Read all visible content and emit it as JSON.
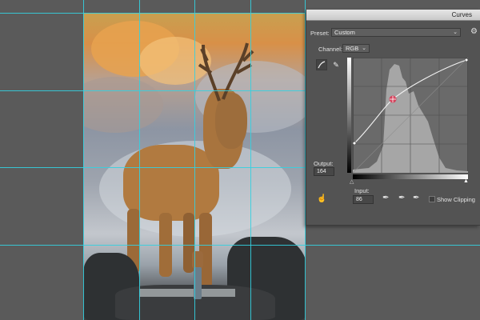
{
  "panel": {
    "title": "Curves",
    "preset_label": "Preset:",
    "preset_value": "Custom",
    "channel_label": "Channel:",
    "channel_value": "RGB",
    "output_label": "Output:",
    "output_value": "164",
    "input_label": "Input:",
    "input_value": "86",
    "show_clipping_label": "Show Clipping",
    "show_clipping_checked": false
  },
  "colors": {
    "guide": "#34d0e0",
    "panel_bg": "#535353",
    "control_point": "#d9314f"
  },
  "icons": [
    "gear-icon",
    "curve-edit-icon",
    "pencil-icon",
    "hand-target-icon",
    "black-eyedropper-icon",
    "gray-eyedropper-icon",
    "white-eyedropper-icon"
  ]
}
